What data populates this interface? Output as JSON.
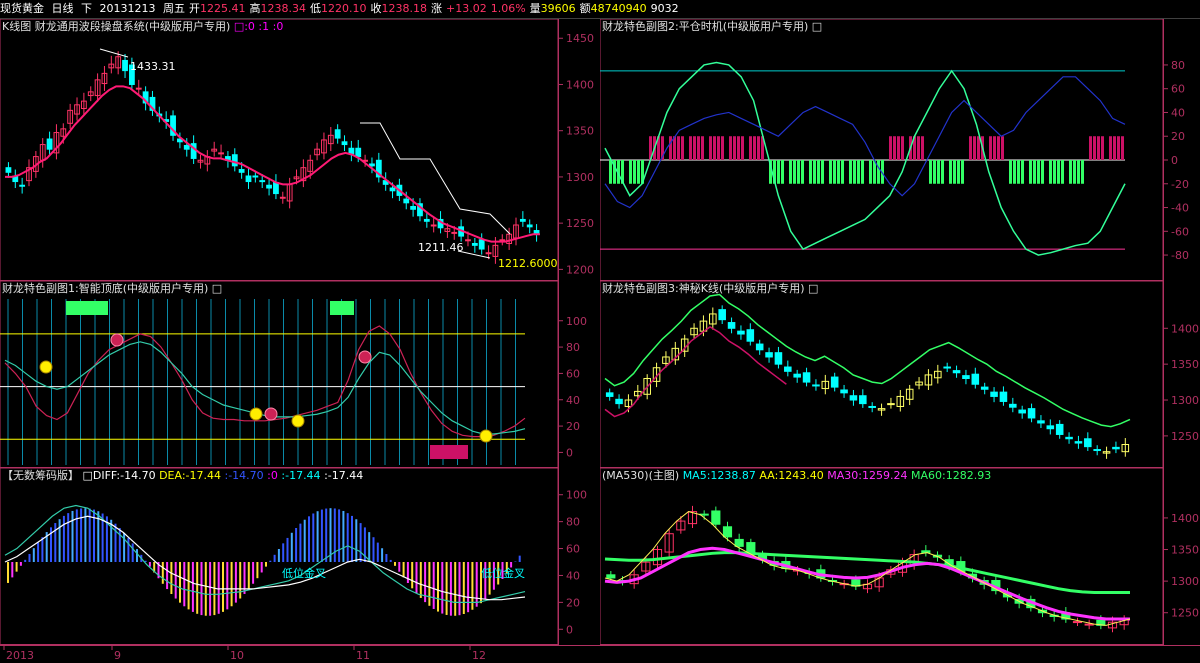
{
  "header": {
    "symbol": "现货黄金",
    "period": "日线",
    "mode": "下",
    "date": "20131213",
    "weekday": "周五",
    "open_label": "开",
    "open": "1225.41",
    "high_label": "高",
    "high": "1238.34",
    "low_label": "低",
    "low": "1220.10",
    "close_label": "收",
    "close": "1238.18",
    "change_label": "涨",
    "change": "+13.02",
    "change_pct": "1.06%",
    "volume_label": "量",
    "volume": "39606",
    "amount_label": "额",
    "amount": "48740940",
    "extra": "9032"
  },
  "colors": {
    "up": "#ff3366",
    "down": "#00ffff",
    "magenta": "#ff00ff",
    "green": "#33ff66",
    "yellow": "#ffff00",
    "axis": "#b03060",
    "blue": "#3355ff"
  },
  "panels": {
    "kline": {
      "title": "K线图",
      "subtitle": "财龙通用波段操盘系统(中级版用户专用)",
      "params": "□:0 :1 :0",
      "yticks": [
        "1450",
        "1400",
        "1350",
        "1300",
        "1250",
        "1200"
      ],
      "annotations": {
        "high": "1433.31",
        "low": "1211.46",
        "last": "1212.6000"
      }
    },
    "sub1": {
      "title": "财龙特色副图1:智能顶底(中级版用户专用) □",
      "yticks": [
        "100",
        "80",
        "60",
        "40",
        "20",
        "0"
      ]
    },
    "sub2": {
      "title": "财龙特色副图2:平仓时机(中级版用户专用) □",
      "yticks": [
        "80",
        "60",
        "40",
        "20",
        "0",
        "-20",
        "-40",
        "-60",
        "-80"
      ]
    },
    "sub3": {
      "title": "财龙特色副图3:神秘K线(中级版用户专用) □",
      "yticks": [
        "1400",
        "1350",
        "1300",
        "1250"
      ]
    },
    "chips": {
      "title": "【无数筹码版】",
      "diff_label": "□DIFF:-14.70",
      "dea_label": "DEA:-17.44",
      "v3": ":-14.70",
      "v4": ":0",
      "v5": ":-17.44",
      "v6": ":-17.44",
      "yticks": [
        "100",
        "80",
        "60",
        "40",
        "20",
        "0"
      ],
      "annot1": "低位金叉",
      "annot2": "低位金叉"
    },
    "ma": {
      "title": "(MA530)(主图)",
      "ma5": "MA5:1238.87",
      "aa": "AA:1243.40",
      "ma30": "MA30:1259.24",
      "ma60": "MA60:1282.93",
      "yticks": [
        "1400",
        "1350",
        "1300",
        "1250"
      ]
    }
  },
  "date_axis": [
    "2013",
    "9",
    "10",
    "11",
    "12"
  ],
  "chart_data": [
    {
      "type": "candlestick",
      "title": "K线图",
      "ylim": [
        1195,
        1460
      ],
      "close": [
        1305,
        1295,
        1290,
        1310,
        1322,
        1335,
        1330,
        1348,
        1352,
        1372,
        1378,
        1382,
        1392,
        1405,
        1412,
        1422,
        1430,
        1415,
        1400,
        1396,
        1380,
        1372,
        1366,
        1360,
        1345,
        1338,
        1330,
        1320,
        1318,
        1322,
        1330,
        1326,
        1318,
        1312,
        1305,
        1295,
        1300,
        1295,
        1288,
        1282,
        1278,
        1292,
        1300,
        1310,
        1318,
        1330,
        1340,
        1345,
        1342,
        1335,
        1325,
        1322,
        1318,
        1312,
        1300,
        1292,
        1285,
        1280,
        1272,
        1265,
        1258,
        1252,
        1248,
        1245,
        1244,
        1240,
        1236,
        1232,
        1226,
        1222,
        1218,
        1226,
        1232,
        1238,
        1248,
        1252,
        1246,
        1238
      ],
      "ma": [
        1300,
        1300,
        1302,
        1306,
        1310,
        1316,
        1320,
        1328,
        1336,
        1346,
        1356,
        1364,
        1372,
        1380,
        1388,
        1394,
        1398,
        1398,
        1396,
        1390,
        1384,
        1376,
        1368,
        1360,
        1352,
        1344,
        1338,
        1332,
        1326,
        1322,
        1320,
        1320,
        1318,
        1316,
        1314,
        1310,
        1306,
        1302,
        1298,
        1294,
        1292,
        1292,
        1294,
        1298,
        1302,
        1308,
        1314,
        1320,
        1324,
        1326,
        1324,
        1320,
        1314,
        1308,
        1302,
        1296,
        1290,
        1284,
        1278,
        1272,
        1266,
        1260,
        1255,
        1250,
        1247,
        1244,
        1241,
        1238,
        1235,
        1232,
        1230,
        1230,
        1230,
        1232,
        1234,
        1236,
        1238,
        1238
      ]
    },
    {
      "type": "line",
      "title": "财龙特色副图1:智能顶底(中级版用户专用)",
      "ylim": [
        -5,
        115
      ],
      "series": [
        {
          "values": [
            68,
            60,
            50,
            35,
            28,
            25,
            30,
            45,
            60,
            70,
            78,
            82,
            86,
            90,
            88,
            80,
            68,
            55,
            40,
            30,
            26,
            25,
            25,
            24,
            24,
            24,
            25,
            26,
            28,
            30,
            32,
            35,
            38,
            55,
            78,
            92,
            96,
            90,
            78,
            60,
            45,
            32,
            22,
            16,
            13,
            12,
            12,
            13,
            16,
            20,
            26
          ]
        },
        {
          "values": [
            70,
            66,
            60,
            54,
            50,
            48,
            50,
            56,
            62,
            68,
            74,
            78,
            82,
            84,
            82,
            76,
            68,
            60,
            50,
            44,
            40,
            36,
            34,
            32,
            30,
            28,
            27,
            27,
            27,
            28,
            29,
            31,
            34,
            42,
            56,
            68,
            76,
            74,
            66,
            56,
            46,
            38,
            30,
            24,
            20,
            16,
            14,
            14,
            15,
            16,
            18
          ]
        }
      ]
    },
    {
      "type": "line",
      "title": "财龙特色副图2:平仓时机(中级版用户专用)",
      "ylim": [
        -85,
        85
      ],
      "series": [
        {
          "values": [
            10,
            -10,
            -30,
            -20,
            10,
            40,
            60,
            70,
            80,
            82,
            80,
            70,
            50,
            10,
            -30,
            -60,
            -75,
            -70,
            -65,
            -60,
            -55,
            -50,
            -40,
            -30,
            -10,
            20,
            40,
            60,
            75,
            60,
            30,
            -10,
            -40,
            -60,
            -75,
            -80,
            -78,
            -75,
            -72,
            -70,
            -60,
            -40,
            -20
          ]
        },
        {
          "values": [
            -20,
            -35,
            -40,
            -30,
            -10,
            10,
            25,
            30,
            35,
            38,
            40,
            35,
            30,
            25,
            20,
            30,
            40,
            45,
            40,
            35,
            30,
            15,
            -5,
            -20,
            -30,
            -20,
            0,
            20,
            40,
            50,
            40,
            30,
            20,
            25,
            40,
            50,
            60,
            70,
            70,
            60,
            50,
            35,
            30
          ]
        }
      ]
    },
    {
      "type": "candlestick",
      "title": "财龙特色副图3:神秘K线(中级版用户专用)",
      "ylim": [
        1215,
        1445
      ],
      "close": [
        1305,
        1295,
        1300,
        1312,
        1330,
        1345,
        1360,
        1372,
        1385,
        1400,
        1410,
        1420,
        1412,
        1400,
        1392,
        1382,
        1370,
        1360,
        1350,
        1340,
        1332,
        1325,
        1320,
        1326,
        1318,
        1310,
        1300,
        1295,
        1290,
        1288,
        1295,
        1305,
        1315,
        1325,
        1335,
        1340,
        1345,
        1338,
        1330,
        1322,
        1315,
        1305,
        1298,
        1290,
        1282,
        1275,
        1268,
        1260,
        1252,
        1246,
        1240,
        1235,
        1230,
        1228,
        1232,
        1238
      ]
    },
    {
      "type": "bar",
      "title": "【无数筹码版】",
      "ylim": [
        -5,
        105
      ],
      "values": [
        62,
        66,
        70,
        75,
        80,
        86,
        90,
        94,
        94,
        90,
        80,
        68,
        52,
        44,
        40,
        38,
        36,
        35,
        35,
        36,
        38,
        40,
        42,
        44,
        46,
        48,
        50,
        52,
        54,
        56,
        60,
        66,
        72,
        78,
        80,
        76,
        68,
        58,
        50,
        42,
        36,
        32,
        28,
        26,
        26,
        28,
        32,
        38,
        44,
        50,
        56
      ],
      "series": [
        {
          "name": "DIFF",
          "values": [
            55,
            60,
            68,
            76,
            84,
            90,
            92,
            90,
            84,
            76,
            68,
            58,
            48,
            40,
            34,
            30,
            28,
            26,
            26,
            27,
            28,
            30,
            32,
            34,
            36,
            40,
            46,
            52,
            58,
            62,
            58,
            50,
            42,
            36,
            30,
            26,
            24,
            22,
            20,
            20,
            20,
            22,
            24,
            26,
            28
          ]
        },
        {
          "name": "DEA",
          "values": [
            50,
            54,
            60,
            66,
            72,
            78,
            82,
            84,
            82,
            78,
            72,
            64,
            56,
            48,
            42,
            38,
            34,
            32,
            30,
            30,
            30,
            30,
            31,
            32,
            33,
            35,
            38,
            42,
            46,
            50,
            52,
            50,
            46,
            42,
            38,
            34,
            31,
            28,
            26,
            24,
            23,
            22,
            22,
            23,
            24
          ]
        }
      ]
    },
    {
      "type": "line",
      "title": "(MA530)(主图)",
      "ylim": [
        1210,
        1460
      ],
      "series": [
        {
          "name": "MA5",
          "values": [
            1305,
            1300,
            1310,
            1330,
            1350,
            1375,
            1395,
            1410,
            1405,
            1390,
            1370,
            1355,
            1345,
            1335,
            1325,
            1320,
            1318,
            1312,
            1305,
            1300,
            1296,
            1292,
            1295,
            1305,
            1318,
            1330,
            1342,
            1345,
            1338,
            1325,
            1315,
            1305,
            1295,
            1285,
            1275,
            1265,
            1258,
            1250,
            1244,
            1240,
            1236,
            1232,
            1230,
            1235,
            1240
          ]
        },
        {
          "name": "MA30",
          "values": [
            1300,
            1298,
            1300,
            1305,
            1315,
            1325,
            1335,
            1345,
            1350,
            1352,
            1350,
            1345,
            1340,
            1335,
            1330,
            1325,
            1320,
            1315,
            1310,
            1308,
            1306,
            1305,
            1306,
            1310,
            1316,
            1322,
            1326,
            1328,
            1326,
            1320,
            1312,
            1304,
            1296,
            1288,
            1280,
            1272,
            1265,
            1258,
            1252,
            1248,
            1245,
            1242,
            1240,
            1240,
            1240
          ]
        },
        {
          "name": "MA60",
          "values": [
            1335,
            1334,
            1333,
            1333,
            1334,
            1336,
            1338,
            1340,
            1342,
            1344,
            1345,
            1345,
            1344,
            1343,
            1342,
            1341,
            1340,
            1339,
            1338,
            1337,
            1336,
            1335,
            1334,
            1333,
            1332,
            1331,
            1330,
            1328,
            1326,
            1324,
            1320,
            1316,
            1312,
            1308,
            1304,
            1300,
            1296,
            1292,
            1288,
            1285,
            1283,
            1282,
            1282,
            1282,
            1282
          ]
        }
      ]
    }
  ]
}
